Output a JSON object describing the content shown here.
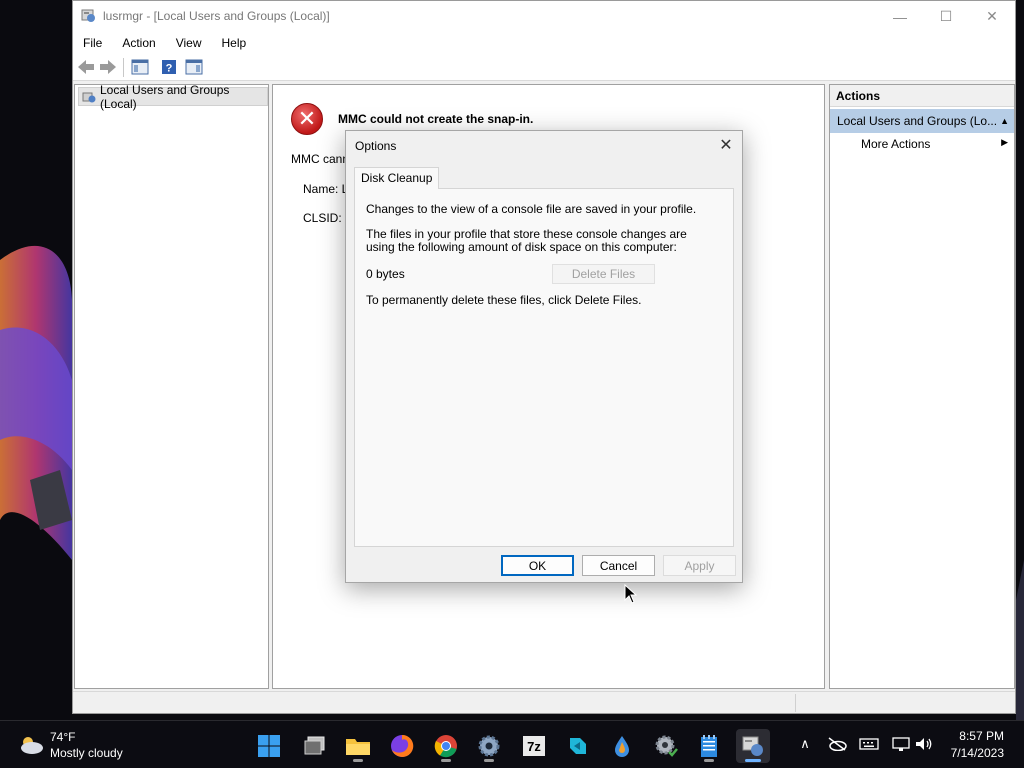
{
  "window": {
    "title": "lusrmgr - [Local Users and Groups (Local)]",
    "minimize_glyph": "—",
    "maximize_glyph": "☐",
    "close_glyph": "✕"
  },
  "menu": {
    "items": [
      {
        "label": "File"
      },
      {
        "label": "Action"
      },
      {
        "label": "View"
      },
      {
        "label": "Help"
      }
    ]
  },
  "toolbar": {
    "icons": [
      "back-arrow-icon",
      "forward-arrow-icon",
      "show-hide-console-tree-icon",
      "help-icon",
      "show-hide-action-pane-icon"
    ]
  },
  "tree": {
    "root_label": "Local Users and Groups (Local)"
  },
  "center": {
    "error_glyph": "✕",
    "error_title": "MMC could not create the snap-in.",
    "error_message": "MMC cann",
    "name_label": "Name: L",
    "clsid_label": "CLSID: {"
  },
  "actions": {
    "header": "Actions",
    "group_label": "Local Users and Groups (Lo...",
    "group_caret": "▲",
    "more_actions": "More Actions",
    "more_caret": "▶"
  },
  "dialog": {
    "title": "Options",
    "close_glyph": "✕",
    "tab_label": "Disk Cleanup",
    "line1": "Changes to the view of a console file are saved in your profile.",
    "line2": "The files in your profile that store these console changes are using the following amount of disk space on this computer:",
    "size_value": "0 bytes",
    "delete_files_label": "Delete Files",
    "line4": "To permanently delete these files, click Delete Files.",
    "ok_label": "OK",
    "cancel_label": "Cancel",
    "apply_label": "Apply"
  },
  "taskbar": {
    "weather_temp": "74°F",
    "weather_desc": "Mostly cloudy",
    "apps": [
      {
        "name": "start-button"
      },
      {
        "name": "task-view"
      },
      {
        "name": "file-explorer"
      },
      {
        "name": "firefox"
      },
      {
        "name": "chrome"
      },
      {
        "name": "settings"
      },
      {
        "name": "7zip"
      },
      {
        "name": "app-blue-arrow"
      },
      {
        "name": "app-drop"
      },
      {
        "name": "app-gear-check"
      },
      {
        "name": "notepad"
      },
      {
        "name": "mmc",
        "active": true
      }
    ],
    "tray_chevron": "∧",
    "clock_time": "8:57 PM",
    "clock_date": "7/14/2023"
  },
  "colors": {
    "accent": "#0067c0",
    "selection": "#b6cde6",
    "error_red": "#c01818",
    "taskbar_bg": "#0c0c12"
  }
}
